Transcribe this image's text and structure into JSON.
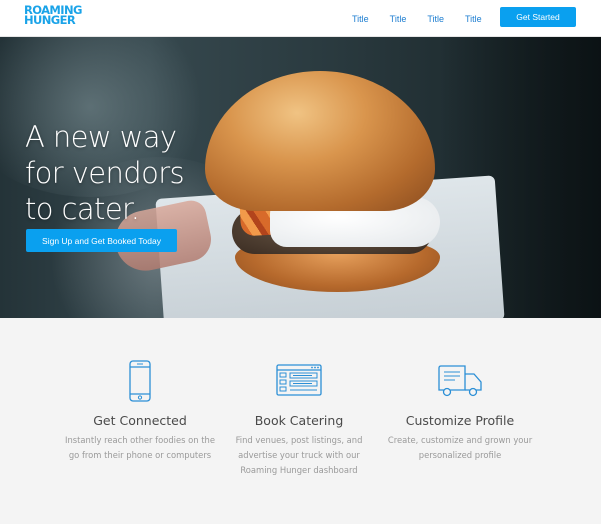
{
  "header": {
    "logo_line1": "ROAMING",
    "logo_line2": "HUNGER",
    "nav": [
      "Title",
      "Title",
      "Title",
      "Title"
    ],
    "cta_label": "Get Started"
  },
  "hero": {
    "headline_line1": "A new way",
    "headline_line2": "for vendors",
    "headline_line3": "to cater.",
    "cta_label": "Sign Up and Get Booked Today"
  },
  "features": [
    {
      "icon": "smartphone-icon",
      "title": "Get Connected",
      "desc_line1": "Instantly reach other foodies on the",
      "desc_line2": "go from their phone or computers"
    },
    {
      "icon": "dashboard-window-icon",
      "title": "Book Catering",
      "desc_line1": "Find venues, post listings, and",
      "desc_line2": "advertise your truck with our",
      "desc_line3": "Roaming Hunger dashboard"
    },
    {
      "icon": "food-truck-icon",
      "title": "Customize Profile",
      "desc_line1": "Create, customize and grown your",
      "desc_line2": "personalized profile"
    }
  ],
  "colors": {
    "accent": "#0aa0ef",
    "logo": "#1aa3e8",
    "nav_link": "#1e7ed1",
    "icon_stroke": "#2b8fd6"
  }
}
